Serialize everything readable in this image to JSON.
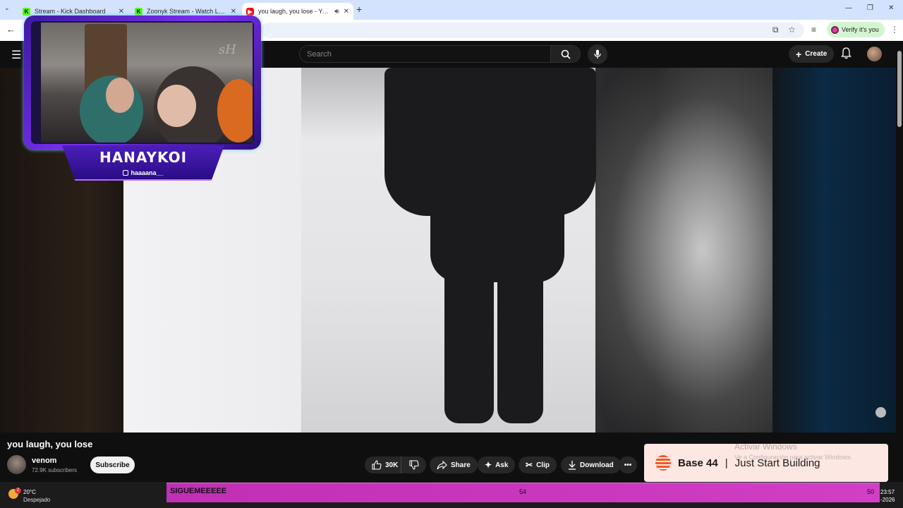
{
  "browser": {
    "tabs": [
      {
        "title": "Stream - Kick Dashboard",
        "icon": "K"
      },
      {
        "title": "Zoonyk Stream - Watch Live on",
        "icon": "K"
      },
      {
        "title": "you laugh, you lose - YouTube",
        "icon": "▶",
        "active": true
      }
    ],
    "new_tab": "+",
    "verify_label": "Verify it's you",
    "window_controls": [
      "—",
      "❐",
      "✕"
    ]
  },
  "youtube": {
    "search_placeholder": "Search",
    "create_label": "Create",
    "video": {
      "title": "you laugh, you lose",
      "channel": "venom",
      "subscribers": "72.9K subscribers",
      "subscribe_label": "Subscribe",
      "likes": "30K",
      "share_label": "Share",
      "ask_label": "Ask",
      "clip_label": "Clip",
      "download_label": "Download"
    }
  },
  "overlay": {
    "streamer_name": "HANAYKOI",
    "instagram": "haaaana__",
    "watermark": "sH"
  },
  "ad": {
    "brand": "Base 44",
    "separator": "|",
    "tagline": "Just Start Building"
  },
  "windows": {
    "activate_title": "Activar Windows",
    "activate_sub": "Ve a Configuración para activar Windows."
  },
  "ticker": {
    "text": "SIGUEMEEEEE",
    "mid": "54",
    "right": "50"
  },
  "taskbar": {
    "weather_badge": "2",
    "temperature": "20°C",
    "condition": "Despejado",
    "time": "23:57",
    "date": "-2026"
  },
  "colors": {
    "youtube_bg": "#0f0f0f",
    "ticker": "#c02fb5",
    "overlay_purple": "#7b2ff2",
    "ad_bg": "#fde7e3"
  }
}
